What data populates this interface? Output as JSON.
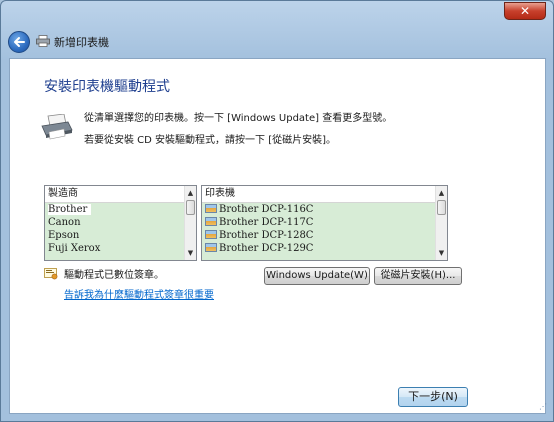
{
  "window": {
    "title": "新增印表機",
    "close_label": "✕"
  },
  "page": {
    "heading": "安裝印表機驅動程式",
    "instruction_1": "從清單選擇您的印表機。按一下 [Windows Update] 查看更多型號。",
    "instruction_2": "若要從安裝 CD 安裝驅動程式，請按一下 [從磁片安裝]。"
  },
  "manufacturer_list": {
    "header": "製造商",
    "items": [
      "Brother",
      "Canon",
      "Epson",
      "Fuji Xerox"
    ],
    "selected": "Brother"
  },
  "printer_list": {
    "header": "印表機",
    "items": [
      "Brother DCP-116C",
      "Brother DCP-117C",
      "Brother DCP-128C",
      "Brother DCP-129C"
    ]
  },
  "signature": {
    "status_text": "驅動程式已數位簽章。",
    "link_text": "告訴我為什麼驅動程式簽章很重要"
  },
  "buttons": {
    "windows_update": "Windows Update(W)",
    "have_disk": "從磁片安裝(H)...",
    "next": "下一步(N)"
  },
  "icons": {
    "back": "back-arrow-icon",
    "printer": "printer-icon",
    "shield": "signed-driver-icon"
  },
  "colors": {
    "heading": "#1f3f8f",
    "link": "#0066cc",
    "list_bg": "#d7ecd6"
  }
}
